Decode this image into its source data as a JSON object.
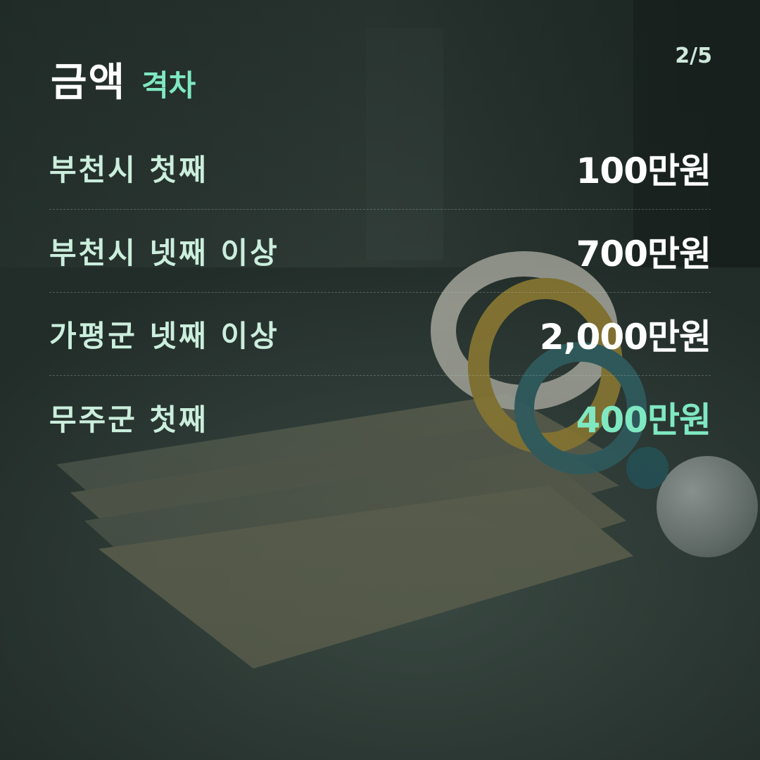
{
  "page_indicator": "2/5",
  "title": {
    "main": "금액",
    "accent": "격차"
  },
  "rows": [
    {
      "label": "부천시 첫째",
      "value": "100만원",
      "highlight": false
    },
    {
      "label": "부천시 넷째 이상",
      "value": "700만원",
      "highlight": false
    },
    {
      "label": "가평군 넷째 이상",
      "value": "2,000만원",
      "highlight": false
    },
    {
      "label": "무주군 첫째",
      "value": "400만원",
      "highlight": true
    }
  ],
  "colors": {
    "accent": "#7fe8c2",
    "label": "#cbeedd",
    "value": "#ffffff",
    "background": "#2c3833"
  }
}
